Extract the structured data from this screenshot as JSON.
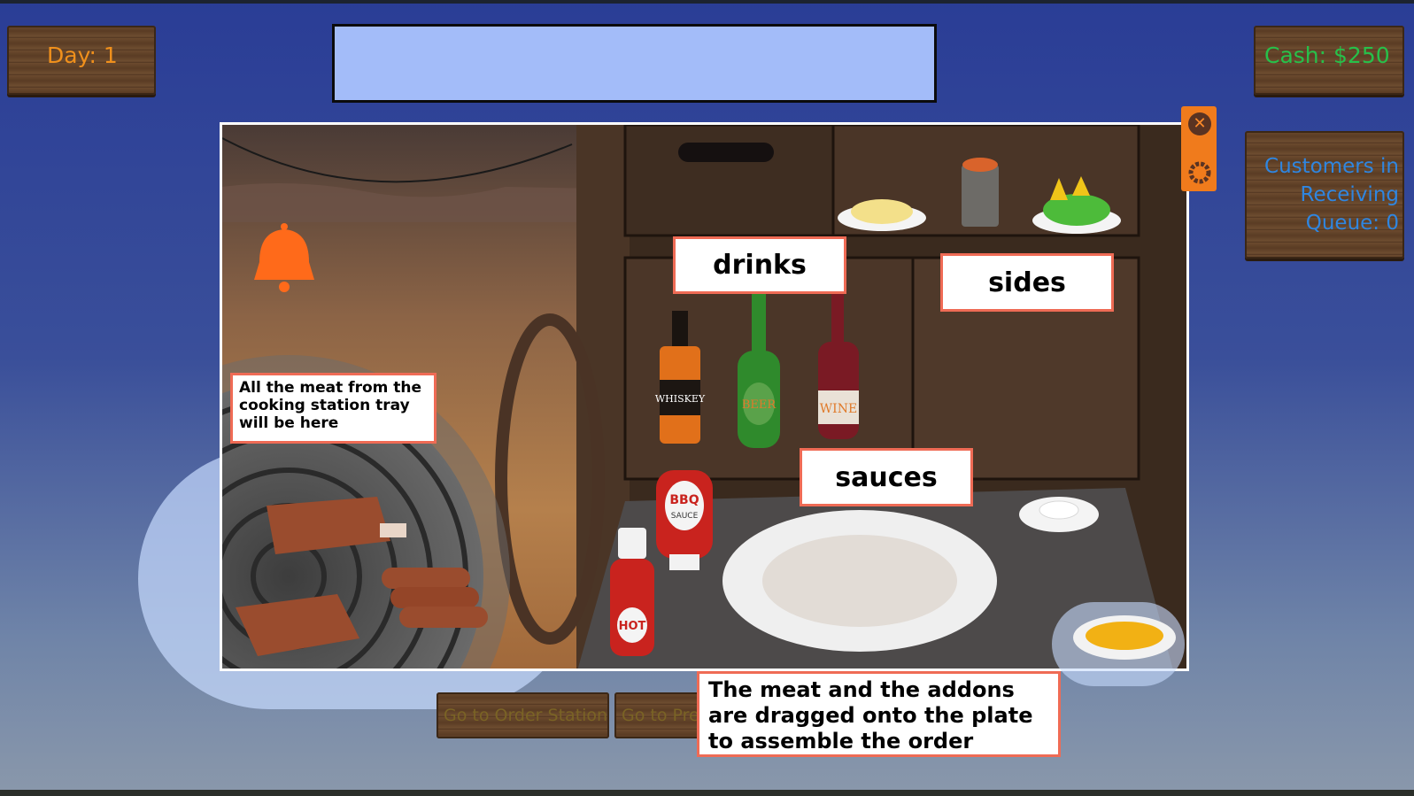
{
  "hud": {
    "day_label": "Day: 1",
    "cash_label": "Cash: $250",
    "queue_line1": "Customers in",
    "queue_line2": "Receiving",
    "queue_line3": "Queue: 0"
  },
  "order_display": {
    "text": ""
  },
  "controls": {
    "close_symbol": "✕"
  },
  "callouts": {
    "drinks": "drinks",
    "sides": "sides",
    "sauces": "sauces",
    "meat_tray": "All the meat from the cooking station tray will be here",
    "plate": "The meat and the addons are dragged onto the plate to assemble the order"
  },
  "bottle_labels": {
    "whiskey": "WHISKEY",
    "beer": "BEER",
    "wine": "WINE",
    "bbq_top": "BBQ",
    "bbq_bottom": "SAUCE",
    "hot": "HOT"
  },
  "nav_buttons": {
    "order_station": "Go to Order Station",
    "prep_station": "Go to Pre"
  },
  "icons": {
    "bell": "bell-icon",
    "close": "close-icon",
    "settings": "gear-icon"
  },
  "colors": {
    "day_text": "#f0901c",
    "cash_text": "#27c04a",
    "queue_text": "#2f86e0",
    "bell": "#ff6a1a",
    "callout_border": "#ef6b55",
    "order_box": "#a3bcf9"
  }
}
